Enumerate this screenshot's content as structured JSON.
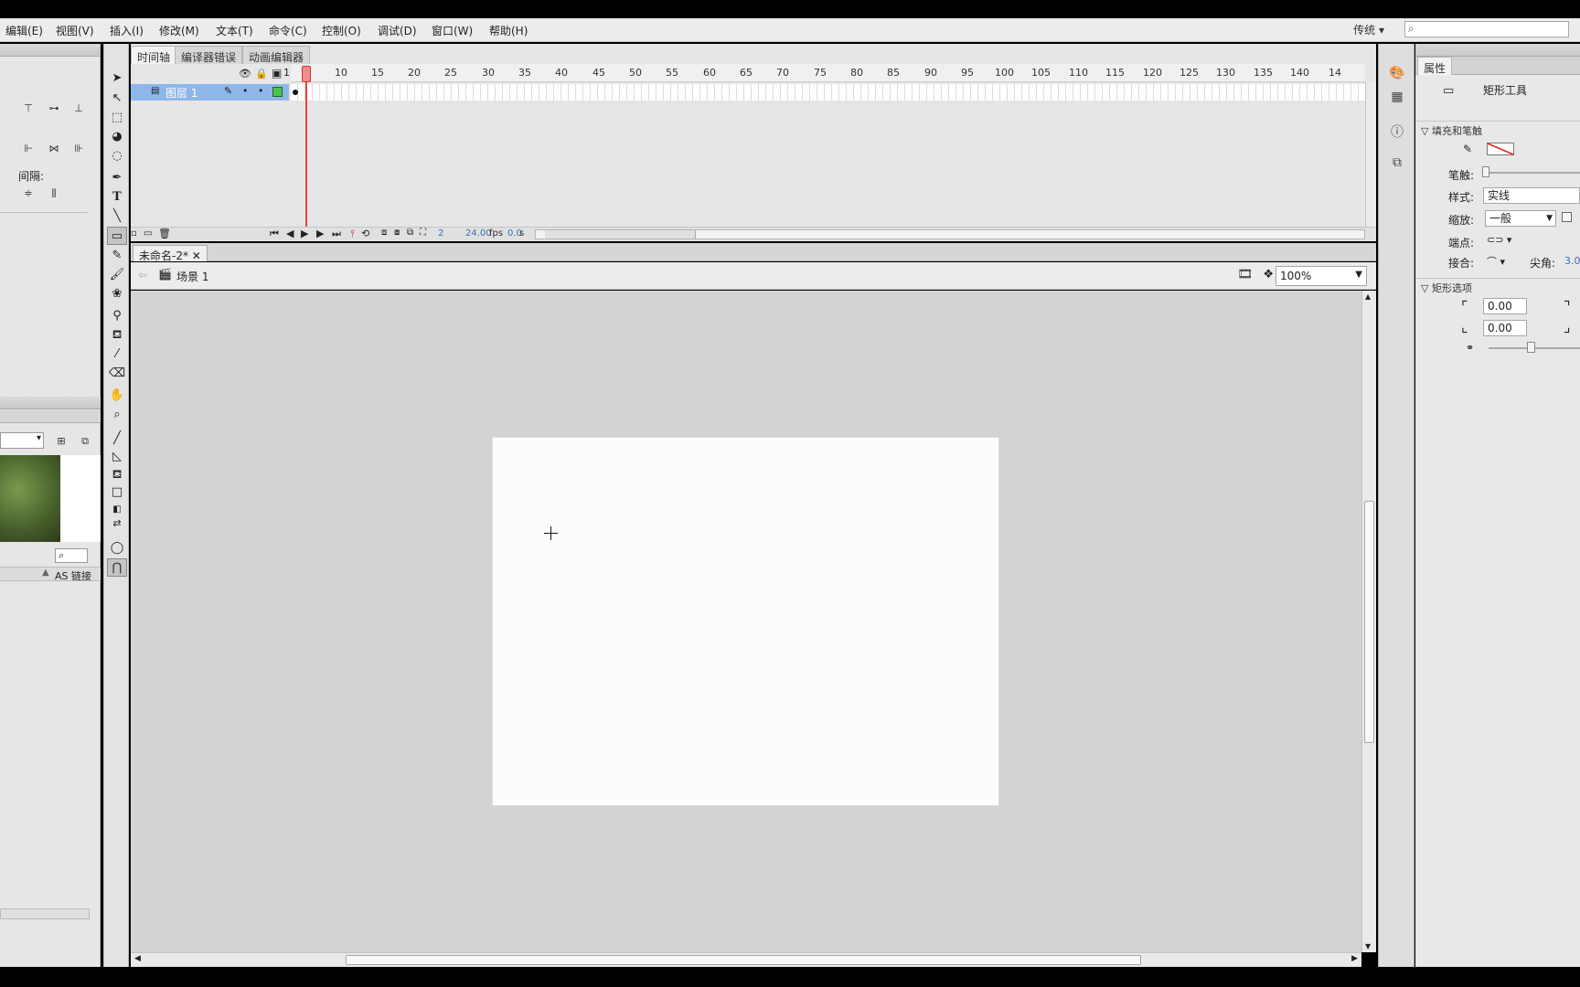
{
  "menu": [
    "编辑(E)",
    "视图(V)",
    "插入(I)",
    "修改(M)",
    "文本(T)",
    "命令(C)",
    "控制(O)",
    "调试(D)",
    "窗口(W)",
    "帮助(H)"
  ],
  "workspace": "传统",
  "timeline": {
    "tabs": [
      "时间轴",
      "编译器错误",
      "动画编辑器"
    ],
    "ruler": [
      "5",
      "10",
      "15",
      "20",
      "25",
      "30",
      "35",
      "40",
      "45",
      "50",
      "55",
      "60",
      "65",
      "70",
      "75",
      "80",
      "85",
      "90",
      "95",
      "100",
      "105",
      "110",
      "115",
      "120",
      "125",
      "130",
      "135",
      "140",
      "14"
    ],
    "first_frame": "1",
    "layer_name": "图层 1",
    "current_frame": "2",
    "fps": "24.00",
    "fps_unit": "fps",
    "time": "0.0",
    "time_unit": "s"
  },
  "left_panel": {
    "spacing_label": "间隔:",
    "as_link": "AS 链接"
  },
  "document": {
    "tab_title": "未命名-2*",
    "scene": "场景 1",
    "zoom": "100%"
  },
  "properties": {
    "tab": "属性",
    "tool_name": "矩形工具",
    "fill_stroke_section": "填充和笔触",
    "stroke_label": "笔触:",
    "style_label": "样式:",
    "style_value": "实线",
    "scale_label": "缩放:",
    "scale_value": "一般",
    "cap_label": "端点:",
    "join_label": "接合:",
    "miter_label": "尖角:",
    "miter_value": "3.0",
    "rect_section": "矩形选项",
    "corner1": "0.00",
    "corner2": "0.00"
  }
}
